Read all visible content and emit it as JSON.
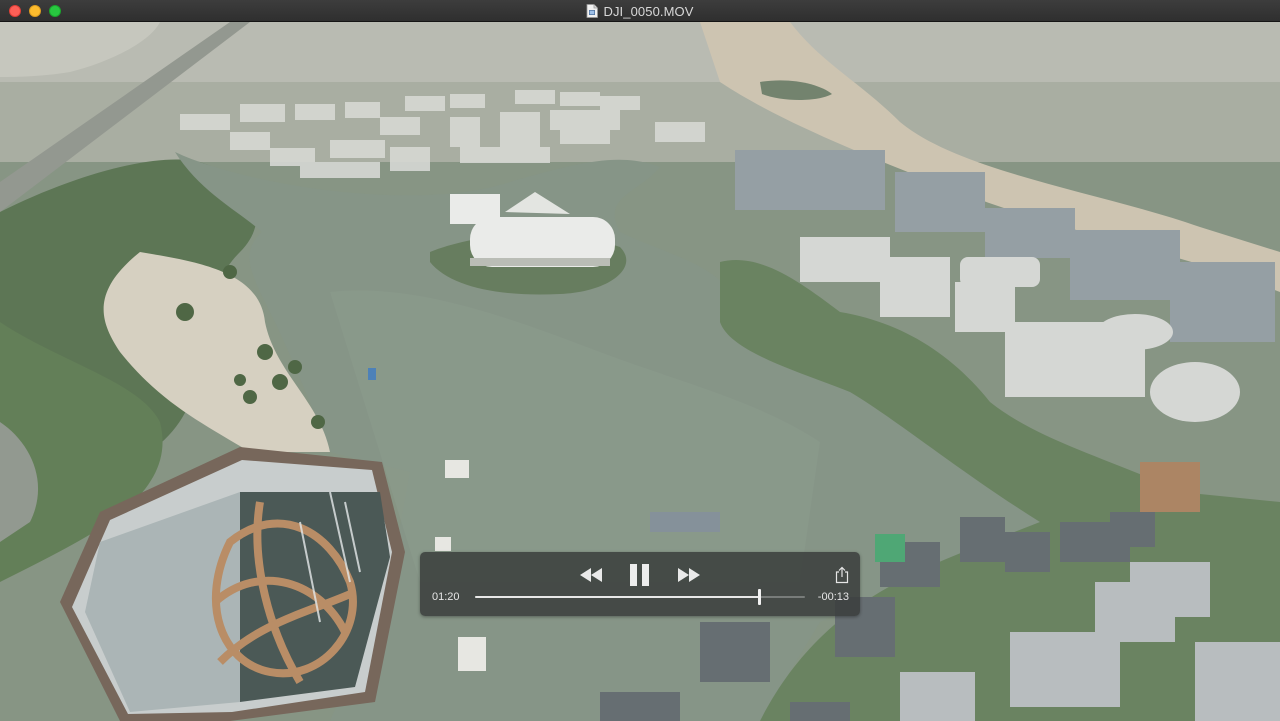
{
  "window": {
    "title": "DJI_0050.MOV"
  },
  "player": {
    "elapsed": "01:20",
    "remaining": "-00:13",
    "progress_fraction": 0.86,
    "state": "playing"
  },
  "colors": {
    "titlebar": "#2f2f2f",
    "close": "#fc5f57",
    "minimize": "#fdbc2e",
    "zoom": "#28c840",
    "hud_background": "#3a3e3c"
  }
}
